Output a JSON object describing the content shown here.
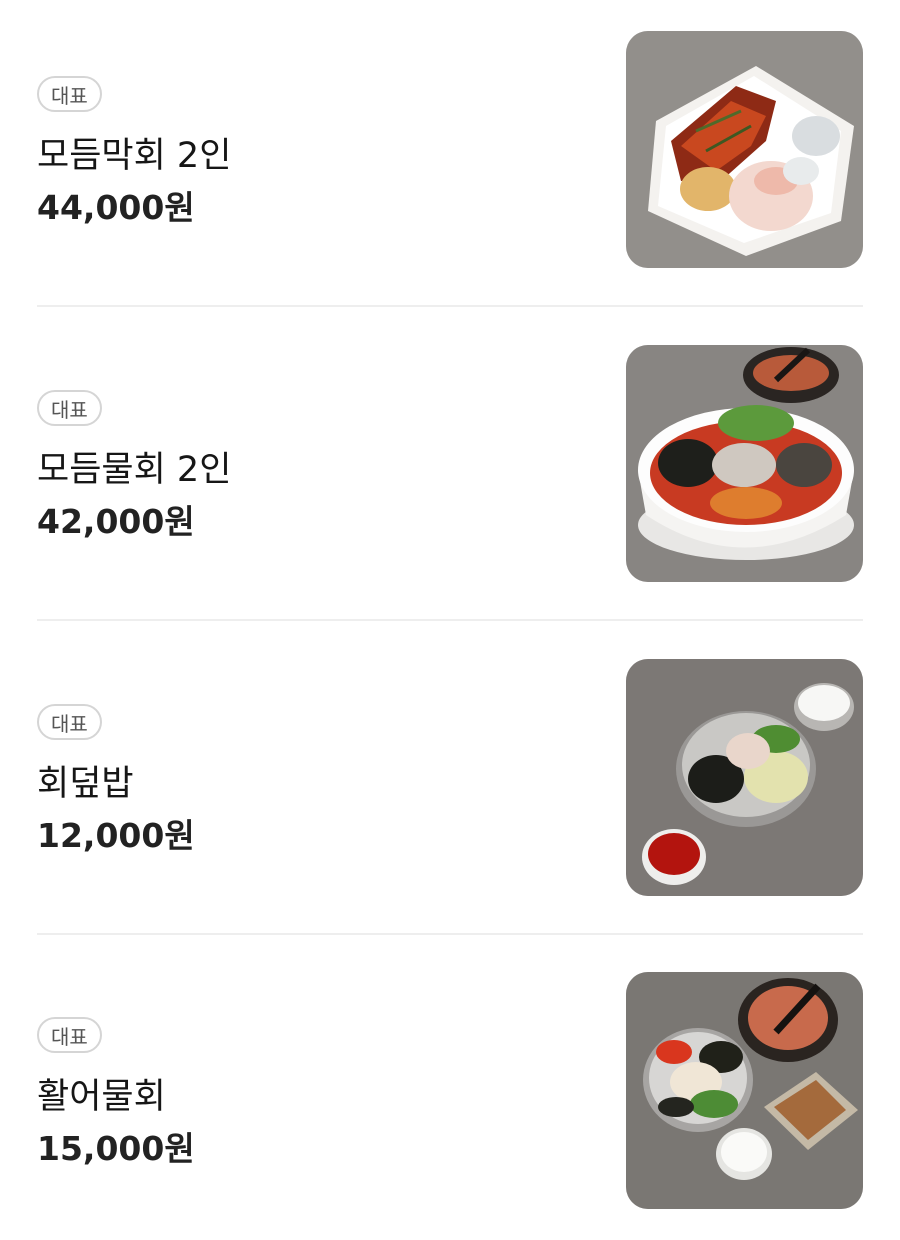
{
  "menu": {
    "items": [
      {
        "badge": "대표",
        "name": "모듬막회 2인",
        "price": "44,000원",
        "image": "mixed-raw-fish-platter-photo"
      },
      {
        "badge": "대표",
        "name": "모듬물회 2인",
        "price": "42,000원",
        "image": "cold-raw-fish-soup-bowl-photo"
      },
      {
        "badge": "대표",
        "name": "회덮밥",
        "price": "12,000원",
        "image": "raw-fish-bibimbap-bowl-photo"
      },
      {
        "badge": "대표",
        "name": "활어물회",
        "price": "15,000원",
        "image": "live-fish-mulhoe-set-photo"
      }
    ]
  },
  "colors": {
    "background": "#ffffff",
    "badge_border": "#d5d5d5",
    "divider": "#eeeeee",
    "text": "#1a1a1a"
  }
}
